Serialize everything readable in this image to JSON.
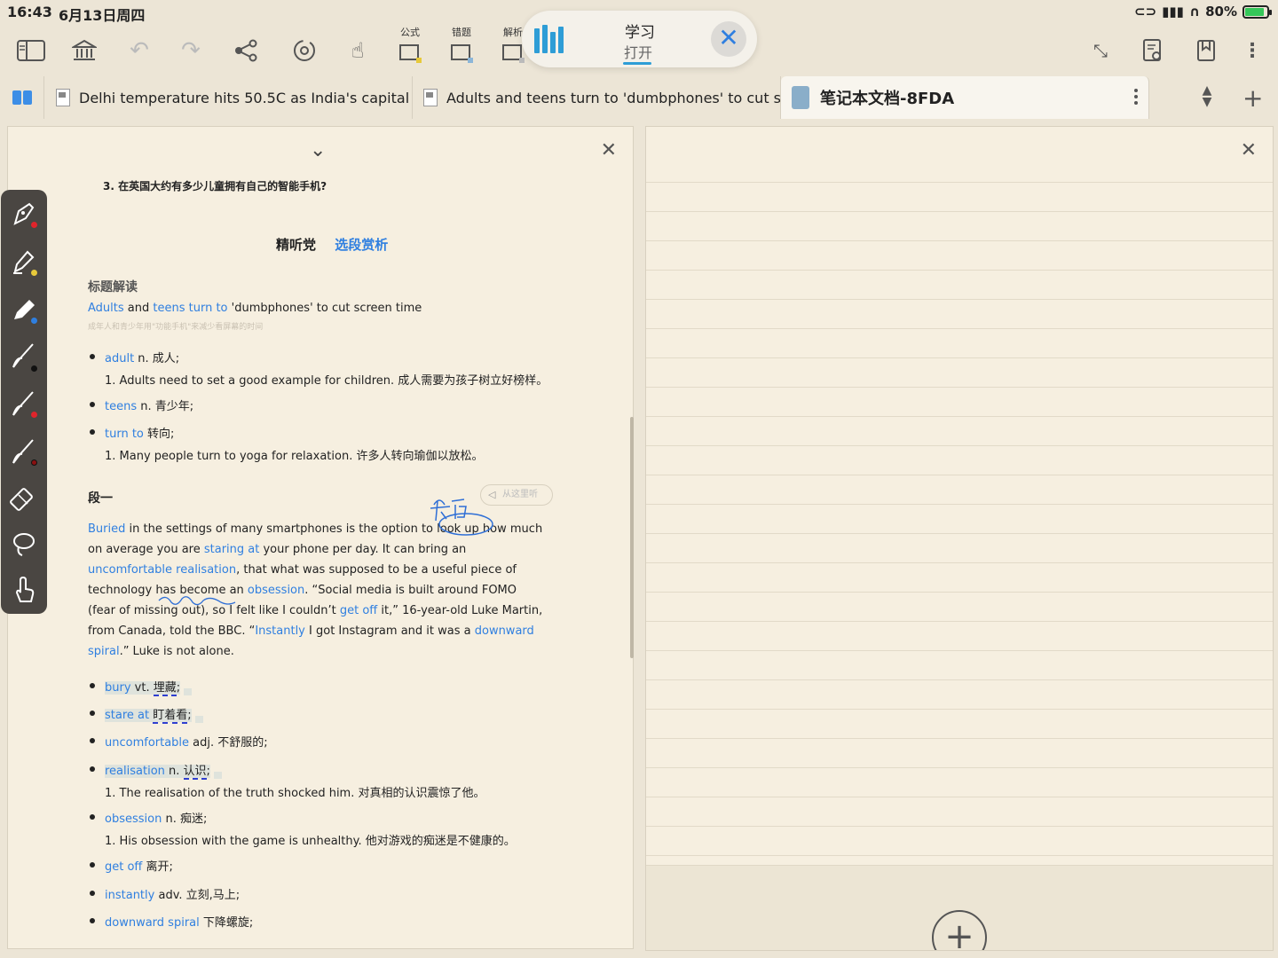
{
  "status_bar": {
    "time": "16:43",
    "date": "6月13日周四",
    "battery": "80%"
  },
  "toolbar": {
    "labels": {
      "formula": "公式",
      "mistakes": "错题",
      "analysis": "解析"
    }
  },
  "popup": {
    "title": "学习",
    "subtitle": "打开"
  },
  "tabs": [
    {
      "label": "Delhi temperature hits 50.5C as India's capital r..."
    },
    {
      "label": "Adults and teens turn to 'dumbphones' to cut s..."
    },
    {
      "label": "笔记本文档-8FDA"
    }
  ],
  "document": {
    "question": "3. 在英国大约有多少儿童拥有自己的智能手机?",
    "heading_a": "精听党",
    "heading_b": "选段赏析",
    "section_title": "标题解读",
    "title_line": {
      "w1": "Adults",
      "t1": " and ",
      "w2": "teens",
      "t2": " ",
      "w3": "turn to",
      "t3": " 'dumbphones' to cut screen time"
    },
    "title_translation": "成年人和青少年用\"功能手机\"来减少看屏幕的时间",
    "vocab_title": [
      {
        "word": "adult",
        "def": " n. 成人;",
        "example": "1. Adults need to set a good example for children. 成人需要为孩子树立好榜样。"
      },
      {
        "word": "teens",
        "def": " n. 青少年;"
      },
      {
        "word": "turn to",
        "def": " 转向;",
        "example": "1. Many people turn to yoga for relaxation. 许多人转向瑜伽以放松。"
      }
    ],
    "paragraph_title": "段一",
    "listen_label": "从这里听",
    "paragraph": {
      "l1_w1": "Buried",
      "l1_t1": " in the settings of many smartphones is the option to look up how much",
      "l2_t1": "on average you are ",
      "l2_w1": "staring at",
      "l2_t2": " your phone per day. It can bring an",
      "l3_w1": "uncomfortable realisation",
      "l3_t1": ", that what was supposed to be a useful piece of",
      "l4_t1": "technology has become an ",
      "l4_w1": "obsession",
      "l4_t2": ". “Social media is built around FOMO",
      "l5_t1": "(fear of missing out), so I felt like I couldn’t ",
      "l5_w1": "get off",
      "l5_t2": " it,” 16-year-old Luke Martin,",
      "l6_t1": "from Canada, told the BBC. “",
      "l6_w1": "Instantly",
      "l6_t2": " I got Instagram and it was a ",
      "l6_w2": "downward",
      "l7_w1": "spiral",
      "l7_t1": ".” Luke is not alone."
    },
    "vocab_para": [
      {
        "word": "bury",
        "pos": " vt. ",
        "def": "埋藏",
        "end": ";"
      },
      {
        "word": "stare at",
        "pos": " ",
        "def": "盯着看",
        "end": ";"
      },
      {
        "word": "uncomfortable",
        "def": " adj. 不舒服的;"
      },
      {
        "word": "realisation",
        "pos": " n. ",
        "def": "认识",
        "end": ";",
        "example": "1. The realisation of the truth shocked him. 对真相的认识震惊了他。"
      },
      {
        "word": "obsession",
        "def": " n. 痴迷;",
        "example": "1. His obsession with the game is unhealthy. 他对游戏的痴迷是不健康的。"
      },
      {
        "word": "get off",
        "def": " 离开;"
      },
      {
        "word": "instantly",
        "def": " adv. 立刻,马上;"
      },
      {
        "word": "downward spiral",
        "def": " 下降螺旋;"
      }
    ]
  },
  "colors": {
    "accent": "#2f7fe0",
    "paper": "#f6efe0",
    "pen_toolbar": "#4a4642"
  },
  "icons": {
    "pen_tools": [
      "fountain-pen-icon",
      "highlighter-icon",
      "pencil-icon",
      "brush-icon",
      "brush-red-icon",
      "brush-dark-icon",
      "eraser-icon",
      "lasso-icon",
      "hand-touch-icon"
    ],
    "pen_tool_colors": [
      "#e0242b",
      "#e7c93a",
      "#2f7fe0",
      "#111111",
      "#e0242b",
      "#8a1010",
      "",
      "",
      ""
    ]
  }
}
